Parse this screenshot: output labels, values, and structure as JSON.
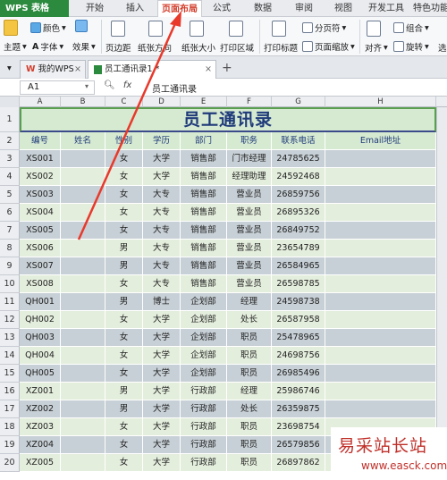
{
  "app": {
    "brand": "WPS 表格"
  },
  "menu": {
    "tabs": [
      {
        "label": "开始"
      },
      {
        "label": "插入"
      },
      {
        "label": "页面布局"
      },
      {
        "label": "公式"
      },
      {
        "label": "数据"
      },
      {
        "label": "审阅"
      },
      {
        "label": "视图"
      },
      {
        "label": "开发工具"
      },
      {
        "label": "特色功能"
      }
    ],
    "active": "页面布局"
  },
  "ribbon": {
    "theme": "主题",
    "colors": "颜色",
    "fonts": "字体",
    "effects": "效果",
    "margins": "页边距",
    "orientation": "纸张方向",
    "size": "纸张大小",
    "print_area": "打印区域",
    "print_titles": "打印标题",
    "breaks": "分页符",
    "page_zoom": "页面缩放",
    "align": "对齐",
    "group": "组合",
    "rotate": "旋转",
    "select": "选"
  },
  "doc_tabs": [
    {
      "label": "我的WPS"
    },
    {
      "label": "员工通讯录1 *"
    }
  ],
  "formula_bar": {
    "name_box": "A1",
    "fx": "fx",
    "content": "员工通讯录"
  },
  "columns": [
    "A",
    "B",
    "C",
    "D",
    "E",
    "F",
    "G",
    "H"
  ],
  "sheet": {
    "title": "员工通讯录",
    "headers": [
      "编号",
      "姓名",
      "性别",
      "学历",
      "部门",
      "职务",
      "联系电话",
      "Email地址"
    ],
    "rows": [
      [
        "XS001",
        "",
        "女",
        "大学",
        "销售部",
        "门市经理",
        "24785625",
        ""
      ],
      [
        "XS002",
        "",
        "女",
        "大学",
        "销售部",
        "经理助理",
        "24592468",
        ""
      ],
      [
        "XS003",
        "",
        "女",
        "大专",
        "销售部",
        "营业员",
        "26859756",
        ""
      ],
      [
        "XS004",
        "",
        "女",
        "大专",
        "销售部",
        "营业员",
        "26895326",
        ""
      ],
      [
        "XS005",
        "",
        "女",
        "大专",
        "销售部",
        "营业员",
        "26849752",
        ""
      ],
      [
        "XS006",
        "",
        "男",
        "大专",
        "销售部",
        "营业员",
        "23654789",
        ""
      ],
      [
        "XS007",
        "",
        "男",
        "大专",
        "销售部",
        "营业员",
        "26584965",
        ""
      ],
      [
        "XS008",
        "",
        "女",
        "大专",
        "销售部",
        "营业员",
        "26598785",
        ""
      ],
      [
        "QH001",
        "",
        "男",
        "博士",
        "企划部",
        "经理",
        "24598738",
        ""
      ],
      [
        "QH002",
        "",
        "女",
        "大学",
        "企划部",
        "处长",
        "26587958",
        ""
      ],
      [
        "QH003",
        "",
        "女",
        "大学",
        "企划部",
        "职员",
        "25478965",
        ""
      ],
      [
        "QH004",
        "",
        "女",
        "大学",
        "企划部",
        "职员",
        "24698756",
        ""
      ],
      [
        "QH005",
        "",
        "女",
        "大学",
        "企划部",
        "职员",
        "26985496",
        ""
      ],
      [
        "XZ001",
        "",
        "男",
        "大学",
        "行政部",
        "经理",
        "25986746",
        ""
      ],
      [
        "XZ002",
        "",
        "男",
        "大学",
        "行政部",
        "处长",
        "26359875",
        ""
      ],
      [
        "XZ003",
        "",
        "女",
        "大学",
        "行政部",
        "职员",
        "23698754",
        ""
      ],
      [
        "XZ004",
        "",
        "女",
        "大学",
        "行政部",
        "职员",
        "26579856",
        ""
      ],
      [
        "XZ005",
        "",
        "女",
        "大学",
        "行政部",
        "职员",
        "26897862",
        ""
      ]
    ]
  },
  "row_numbers": [
    "1",
    "2",
    "3",
    "4",
    "5",
    "6",
    "7",
    "8",
    "9",
    "10",
    "11",
    "12",
    "13",
    "14",
    "15",
    "16",
    "17",
    "18",
    "19",
    "20"
  ],
  "watermark": {
    "line1": "易采站长站",
    "line2": "www.easck.com"
  },
  "colors": {
    "accent": "#d23c2a",
    "title_text": "#1f3a7a",
    "band_dark": "#c7d0d6",
    "band_light": "#e4eedd"
  }
}
